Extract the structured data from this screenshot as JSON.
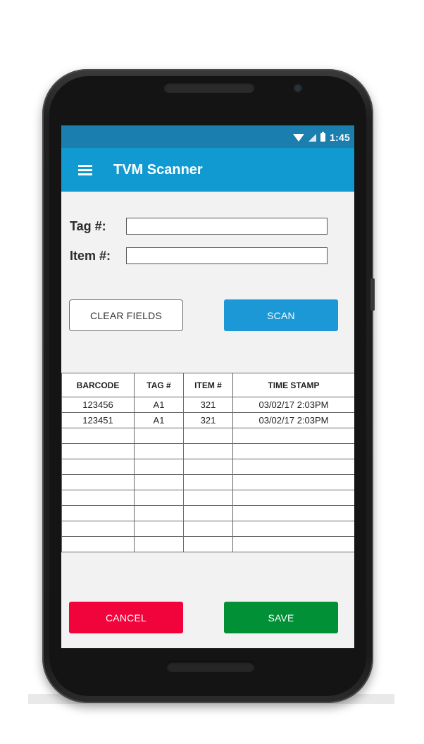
{
  "status_bar": {
    "time": "1:45"
  },
  "app_bar": {
    "title": "TVM Scanner"
  },
  "form": {
    "tag_label": "Tag #:",
    "tag_value": "",
    "item_label": "Item #:",
    "item_value": ""
  },
  "buttons": {
    "clear_label": "CLEAR FIELDS",
    "scan_label": "SCAN",
    "cancel_label": "CANCEL",
    "save_label": "SAVE"
  },
  "colors": {
    "status_bar": "#1a7fae",
    "app_bar": "#119ad1",
    "scan_button": "#1b98d5",
    "cancel_button": "#f1043b",
    "save_button": "#029037"
  },
  "table": {
    "headers": [
      "BARCODE",
      "TAG #",
      "ITEM #",
      "TIME STAMP"
    ],
    "rows": [
      [
        "123456",
        "A1",
        "321",
        "03/02/17 2:03PM"
      ],
      [
        "123451",
        "A1",
        "321",
        "03/02/17 2:03PM"
      ],
      [
        "",
        "",
        "",
        ""
      ],
      [
        "",
        "",
        "",
        ""
      ],
      [
        "",
        "",
        "",
        ""
      ],
      [
        "",
        "",
        "",
        ""
      ],
      [
        "",
        "",
        "",
        ""
      ],
      [
        "",
        "",
        "",
        ""
      ],
      [
        "",
        "",
        "",
        ""
      ],
      [
        "",
        "",
        "",
        ""
      ]
    ]
  }
}
